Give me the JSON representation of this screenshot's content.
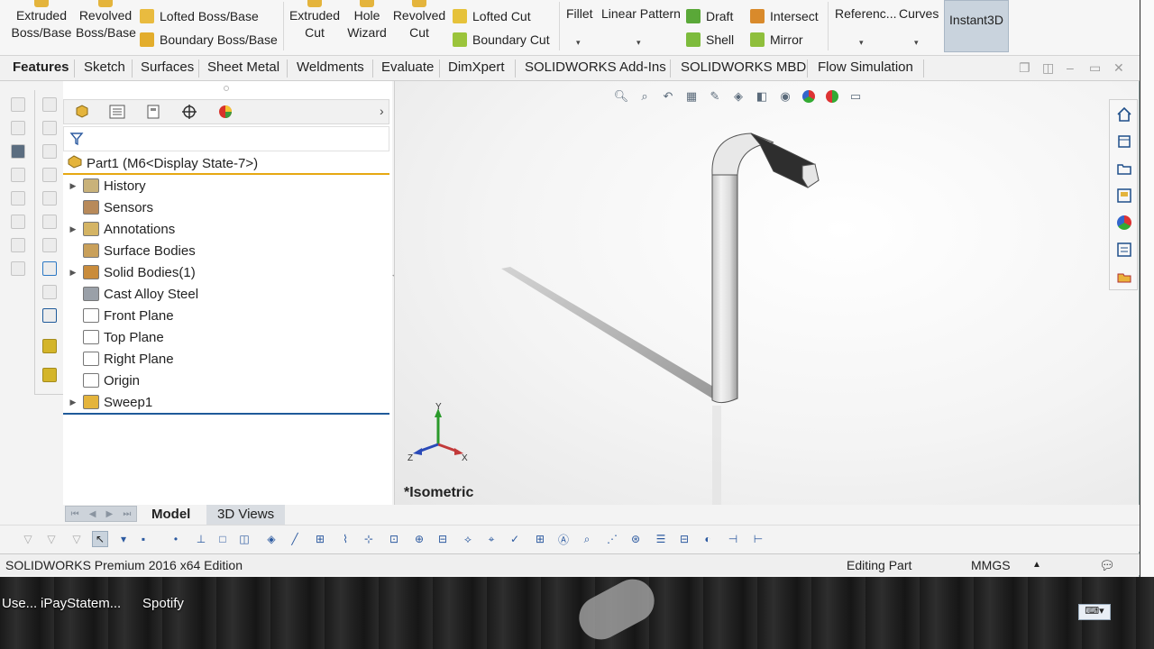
{
  "ribbon": {
    "extruded_boss": [
      "Extruded",
      "Boss/Base"
    ],
    "revolved_boss": [
      "Revolved",
      "Boss/Base"
    ],
    "lofted_boss": "Lofted Boss/Base",
    "boundary_boss": "Boundary Boss/Base",
    "extruded_cut": [
      "Extruded",
      "Cut"
    ],
    "hole_wizard": [
      "Hole",
      "Wizard"
    ],
    "revolved_cut": [
      "Revolved",
      "Cut"
    ],
    "lofted_cut": "Lofted Cut",
    "boundary_cut": "Boundary Cut",
    "fillet": "Fillet",
    "linear_pattern": "Linear Pattern",
    "draft": "Draft",
    "shell": "Shell",
    "intersect": "Intersect",
    "mirror": "Mirror",
    "reference": "Referenc...",
    "curves": "Curves",
    "instant3d": "Instant3D"
  },
  "tabs": [
    "Features",
    "Sketch",
    "Surfaces",
    "Sheet Metal",
    "Weldments",
    "Evaluate",
    "DimXpert",
    "SOLIDWORKS Add-Ins",
    "SOLIDWORKS MBD",
    "Flow Simulation"
  ],
  "tree": {
    "root": "Part1  (M6<Display State-7>)",
    "items": [
      {
        "label": "History",
        "expandable": true
      },
      {
        "label": "Sensors",
        "expandable": false
      },
      {
        "label": "Annotations",
        "expandable": true
      },
      {
        "label": "Surface Bodies",
        "expandable": false
      },
      {
        "label": "Solid Bodies(1)",
        "expandable": true
      },
      {
        "label": "Cast Alloy Steel",
        "expandable": false
      },
      {
        "label": "Front Plane",
        "expandable": false
      },
      {
        "label": "Top Plane",
        "expandable": false
      },
      {
        "label": "Right Plane",
        "expandable": false
      },
      {
        "label": "Origin",
        "expandable": false
      },
      {
        "label": "Sweep1",
        "expandable": true
      }
    ]
  },
  "viewport": {
    "view_label": "*Isometric",
    "triad": {
      "x": "X",
      "y": "Y",
      "z": "Z"
    }
  },
  "bottom_tabs": [
    "Model",
    "3D Views"
  ],
  "status": {
    "edition": "SOLIDWORKS Premium 2016 x64 Edition",
    "mode": "Editing Part",
    "units": "MMGS"
  },
  "desktop": {
    "items": [
      "Use...",
      "iPayStatem...",
      "Spotify"
    ]
  },
  "colors": {
    "accent_yellow": "#e6a812",
    "tree_end_blue": "#1f5a9a",
    "instant3d_bg": "#c9d3dd"
  }
}
